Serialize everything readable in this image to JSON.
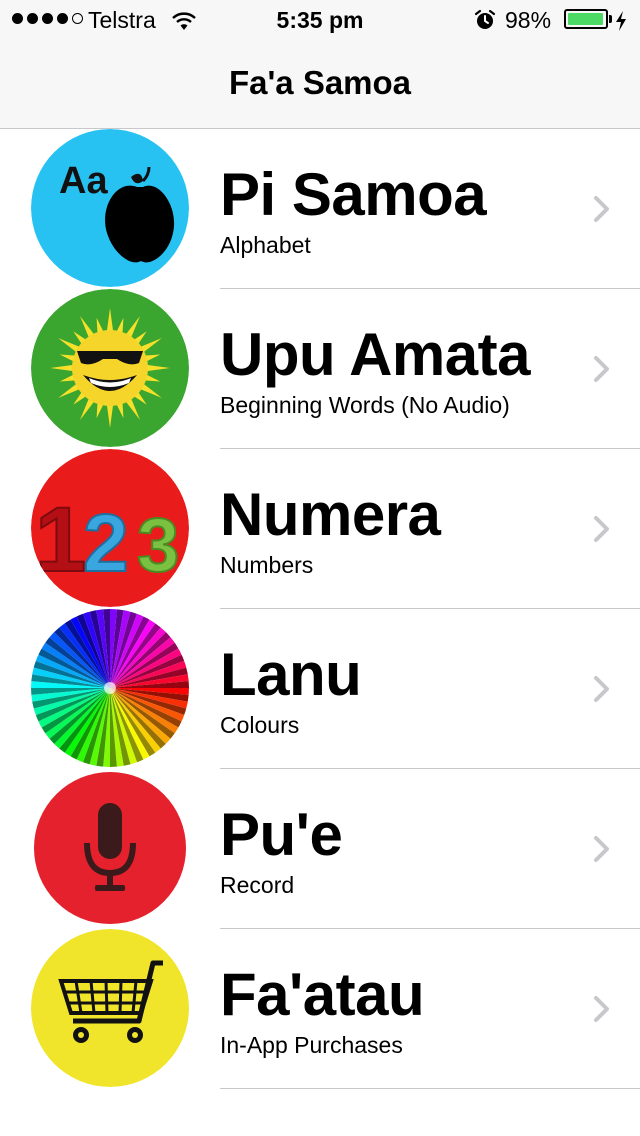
{
  "status_bar": {
    "carrier": "Telstra",
    "time": "5:35 pm",
    "battery_percent": "98%",
    "battery_level": 0.98,
    "signal_bars_filled": 4,
    "signal_bars_total": 5
  },
  "nav": {
    "title": "Fa'a Samoa"
  },
  "menu": {
    "items": [
      {
        "title": "Pi Samoa",
        "subtitle": "Alphabet",
        "icon": "alphabet-apple-icon",
        "color": "#27c2f2"
      },
      {
        "title": "Upu Amata",
        "subtitle": "Beginning Words (No Audio)",
        "icon": "sun-icon",
        "color": "#3aa52f"
      },
      {
        "title": "Numera",
        "subtitle": "Numbers",
        "icon": "numbers-123-icon",
        "color": "#ea1b1b"
      },
      {
        "title": "Lanu",
        "subtitle": "Colours",
        "icon": "color-burst-icon",
        "color": "#ffffff"
      },
      {
        "title": "Pu'e",
        "subtitle": "Record",
        "icon": "microphone-icon",
        "color": "#e4212c"
      },
      {
        "title": "Fa'atau",
        "subtitle": "In-App Purchases",
        "icon": "shopping-cart-icon",
        "color": "#f0e52a"
      }
    ]
  }
}
